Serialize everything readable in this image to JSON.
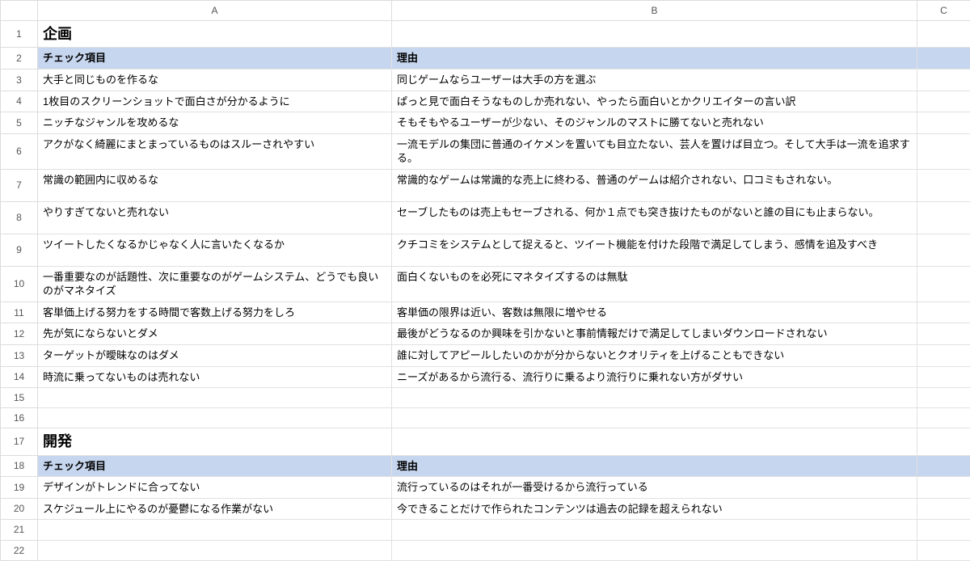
{
  "columns": {
    "A": "A",
    "B": "B",
    "C": "C"
  },
  "rows": [
    {
      "n": 1,
      "type": "section",
      "a": "企画",
      "b": "",
      "c": ""
    },
    {
      "n": 2,
      "type": "subheader",
      "a": "チェック項目",
      "b": "理由",
      "c": ""
    },
    {
      "n": 3,
      "type": "data",
      "a": "大手と同じものを作るな",
      "b": "同じゲームならユーザーは大手の方を選ぶ",
      "c": ""
    },
    {
      "n": 4,
      "type": "data",
      "a": "1枚目のスクリーンショットで面白さが分かるように",
      "b": "ぱっと見で面白そうなものしか売れない、やったら面白いとかクリエイターの言い訳",
      "c": ""
    },
    {
      "n": 5,
      "type": "data",
      "a": "ニッチなジャンルを攻めるな",
      "b": "そもそもやるユーザーが少ない、そのジャンルのマストに勝てないと売れない",
      "c": ""
    },
    {
      "n": 6,
      "type": "data tall",
      "a": "アクがなく綺麗にまとまっているものはスルーされやすい",
      "b": "一流モデルの集団に普通のイケメンを置いても目立たない、芸人を置けば目立つ。そして大手は一流を追求する。",
      "c": ""
    },
    {
      "n": 7,
      "type": "data tall",
      "a": "常識の範囲内に収めるな",
      "b": "常識的なゲームは常識的な売上に終わる、普通のゲームは紹介されない、口コミもされない。",
      "c": ""
    },
    {
      "n": 8,
      "type": "data tall",
      "a": "やりすぎてないと売れない",
      "b": "セーブしたものは売上もセーブされる、何か１点でも突き抜けたものがないと誰の目にも止まらない。",
      "c": ""
    },
    {
      "n": 9,
      "type": "data tall",
      "a": "ツイートしたくなるかじゃなく人に言いたくなるか",
      "b": "クチコミをシステムとして捉えると、ツイート機能を付けた段階で満足してしまう、感情を追及すべき",
      "c": ""
    },
    {
      "n": 10,
      "type": "data tall",
      "a": "一番重要なのが話題性、次に重要なのがゲームシステム、どうでも良いのがマネタイズ",
      "b": "面白くないものを必死にマネタイズするのは無駄",
      "c": ""
    },
    {
      "n": 11,
      "type": "data",
      "a": "客単価上げる努力をする時間で客数上げる努力をしろ",
      "b": "客単価の限界は近い、客数は無限に増やせる",
      "c": ""
    },
    {
      "n": 12,
      "type": "data",
      "a": "先が気にならないとダメ",
      "b": "最後がどうなるのか興味を引かないと事前情報だけで満足してしまいダウンロードされない",
      "c": ""
    },
    {
      "n": 13,
      "type": "data",
      "a": "ターゲットが曖昧なのはダメ",
      "b": "誰に対してアピールしたいのかが分からないとクオリティを上げることもできない",
      "c": ""
    },
    {
      "n": 14,
      "type": "data",
      "a": "時流に乗ってないものは売れない",
      "b": "ニーズがあるから流行る、流行りに乗るより流行りに乗れない方がダサい",
      "c": ""
    },
    {
      "n": 15,
      "type": "empty",
      "a": "",
      "b": "",
      "c": ""
    },
    {
      "n": 16,
      "type": "empty",
      "a": "",
      "b": "",
      "c": ""
    },
    {
      "n": 17,
      "type": "section",
      "a": "開発",
      "b": "",
      "c": ""
    },
    {
      "n": 18,
      "type": "subheader",
      "a": "チェック項目",
      "b": "理由",
      "c": ""
    },
    {
      "n": 19,
      "type": "data",
      "a": "デザインがトレンドに合ってない",
      "b": "流行っているのはそれが一番受けるから流行っている",
      "c": ""
    },
    {
      "n": 20,
      "type": "data",
      "a": "スケジュール上にやるのが憂鬱になる作業がない",
      "b": "今できることだけで作られたコンテンツは過去の記録を超えられない",
      "c": ""
    },
    {
      "n": 21,
      "type": "empty",
      "a": "",
      "b": "",
      "c": ""
    },
    {
      "n": 22,
      "type": "empty",
      "a": "",
      "b": "",
      "c": ""
    }
  ]
}
